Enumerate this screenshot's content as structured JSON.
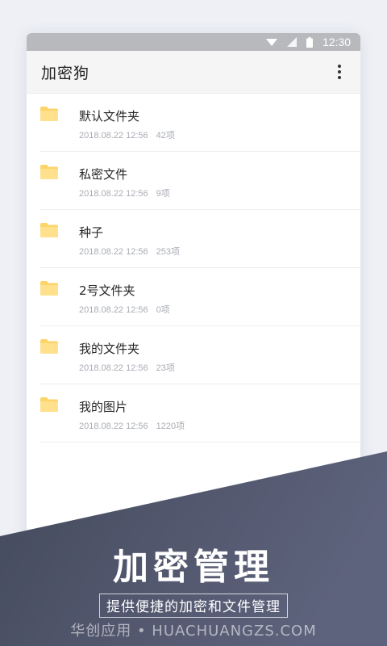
{
  "statusbar": {
    "time": "12:30",
    "icons": [
      "wifi-icon",
      "signal-icon",
      "battery-icon"
    ]
  },
  "appbar": {
    "title": "加密狗",
    "menu_icon": "more-vert-icon"
  },
  "folders": [
    {
      "name": "默认文件夹",
      "date": "2018.08.22 12:56",
      "count": "42项"
    },
    {
      "name": "私密文件",
      "date": "2018.08.22 12:56",
      "count": "9项"
    },
    {
      "name": "种子",
      "date": "2018.08.22 12:56",
      "count": "253项"
    },
    {
      "name": "2号文件夹",
      "date": "2018.08.22 12:56",
      "count": "0项"
    },
    {
      "name": "我的文件夹",
      "date": "2018.08.22 12:56",
      "count": "23项"
    },
    {
      "name": "我的图片",
      "date": "2018.08.22 12:56",
      "count": "1220项"
    }
  ],
  "banner": {
    "headline": "加密管理",
    "subline": "提供便捷的加密和文件管理",
    "watermark": "华创应用 • HUACHUANGZS.COM"
  },
  "colors": {
    "folder": "#fdd46a",
    "banner_dark": "#444a5c",
    "banner_light": "#5e637d",
    "statusbar": "#b7b9bd"
  }
}
